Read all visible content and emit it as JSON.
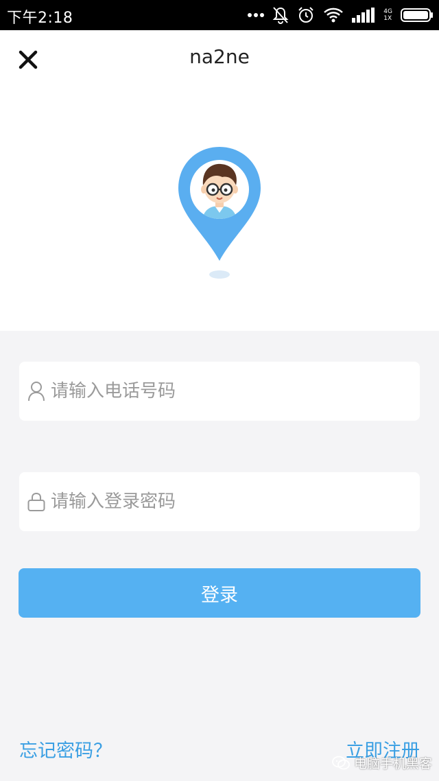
{
  "status_bar": {
    "time": "下午2:18",
    "network_label": "4G",
    "network_sub": "1X"
  },
  "header": {
    "title": "na2ne",
    "close_icon": "close-icon"
  },
  "form": {
    "phone_placeholder": "请输入电话号码",
    "password_placeholder": "请输入登录密码",
    "login_label": "登录"
  },
  "footer": {
    "forgot_label": "忘记密码？",
    "register_label": "立即注册"
  },
  "watermark": {
    "text": "电脑手机黑客"
  },
  "colors": {
    "accent": "#55b1f2",
    "link": "#3a9fe3",
    "pin": "#5aaef0",
    "page_bg": "#f4f4f6"
  }
}
